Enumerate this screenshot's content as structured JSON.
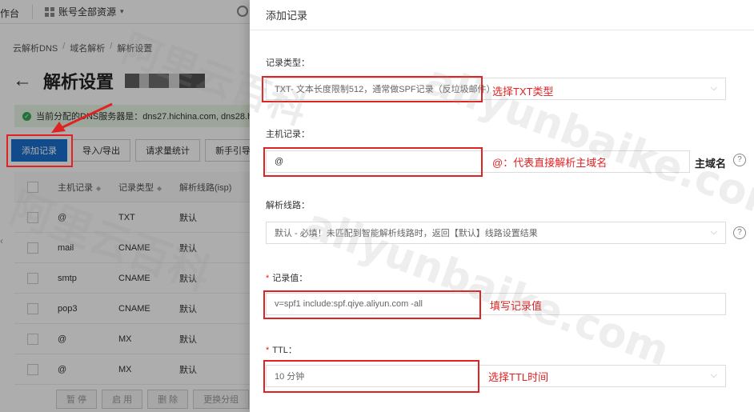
{
  "topbar": {
    "workbench": "作台",
    "account_scope": "账号全部资源"
  },
  "breadcrumb": [
    "云解析DNS",
    "域名解析",
    "解析设置"
  ],
  "page": {
    "title": "解析设置"
  },
  "notice": {
    "text": "当前分配的DNS服务器是：dns27.hichina.com, dns28.hichi"
  },
  "toolbar": {
    "add_record": "添加记录",
    "import_export": "导入/导出",
    "request_stats": "请求量统计",
    "beginner_guide": "新手引导"
  },
  "table": {
    "headers": [
      "主机记录",
      "记录类型",
      "解析线路(isp)"
    ],
    "rows": [
      {
        "host": "@",
        "type": "TXT",
        "line": "默认"
      },
      {
        "host": "mail",
        "type": "CNAME",
        "line": "默认"
      },
      {
        "host": "smtp",
        "type": "CNAME",
        "line": "默认"
      },
      {
        "host": "pop3",
        "type": "CNAME",
        "line": "默认"
      },
      {
        "host": "@",
        "type": "MX",
        "line": "默认"
      },
      {
        "host": "@",
        "type": "MX",
        "line": "默认"
      }
    ],
    "footer_buttons": [
      "暂 停",
      "启 用",
      "删 除",
      "更换分组"
    ]
  },
  "drawer": {
    "title": "添加记录",
    "record_type": {
      "label": "记录类型：",
      "value": "TXT- 文本长度限制512，通常做SPF记录（反垃圾邮件）",
      "annotation": "选择TXT类型"
    },
    "host_record": {
      "label": "主机记录：",
      "value": "@",
      "annotation": "@：代表直接解析主域名",
      "suffix": "主域名"
    },
    "resolve_line": {
      "label": "解析线路：",
      "value": "默认 - 必填！未匹配到智能解析线路时，返回【默认】线路设置结果"
    },
    "record_value": {
      "label": "记录值：",
      "value": "v=spf1 include:spf.qiye.aliyun.com -all",
      "annotation": "填写记录值"
    },
    "ttl": {
      "label": "TTL：",
      "value": "10 分钟",
      "annotation": "选择TTL时间"
    }
  },
  "watermark": {
    "cn": "阿里云百科",
    "en": "aliyunbaike.com"
  },
  "colors": {
    "annotation_red": "#e02222",
    "primary_blue": "#1a6fcf",
    "success_green": "#34a853"
  }
}
